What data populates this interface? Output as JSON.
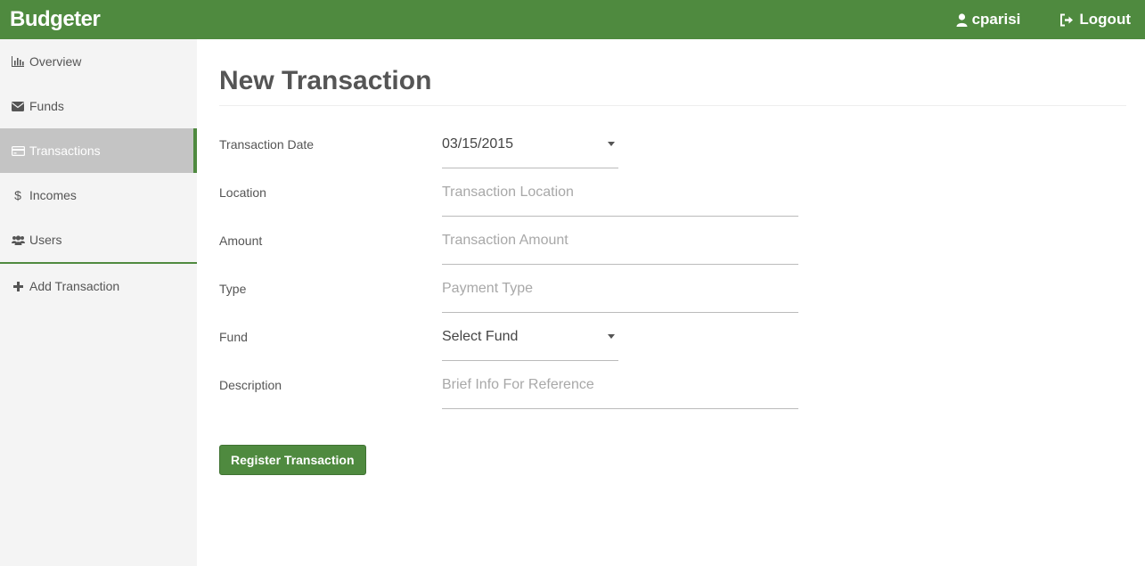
{
  "app": {
    "brand": "Budgeter"
  },
  "header": {
    "user": {
      "icon": "user-icon",
      "label": "cparisi"
    },
    "logout": {
      "icon": "logout-icon",
      "label": "Logout"
    }
  },
  "sidebar": {
    "items": [
      {
        "label": "Overview",
        "icon": "bar-chart-icon"
      },
      {
        "label": "Funds",
        "icon": "envelope-icon"
      },
      {
        "label": "Transactions",
        "icon": "credit-card-icon",
        "active": true
      },
      {
        "label": "Incomes",
        "icon": "dollar-icon"
      },
      {
        "label": "Users",
        "icon": "users-icon"
      }
    ],
    "add": {
      "label": "Add Transaction",
      "icon": "plus-icon"
    }
  },
  "main": {
    "title": "New Transaction",
    "form": {
      "date": {
        "label": "Transaction Date",
        "value": "03/15/2015"
      },
      "location": {
        "label": "Location",
        "placeholder": "Transaction Location"
      },
      "amount": {
        "label": "Amount",
        "placeholder": "Transaction Amount"
      },
      "type": {
        "label": "Type",
        "placeholder": "Payment Type"
      },
      "fund": {
        "label": "Fund",
        "value": "Select Fund"
      },
      "description": {
        "label": "Description",
        "placeholder": "Brief Info For Reference"
      }
    },
    "submit_label": "Register Transaction"
  },
  "colors": {
    "brand": "#4f8a3f",
    "active_bg": "#c4c4c4",
    "sidebar_bg": "#f4f4f4"
  }
}
